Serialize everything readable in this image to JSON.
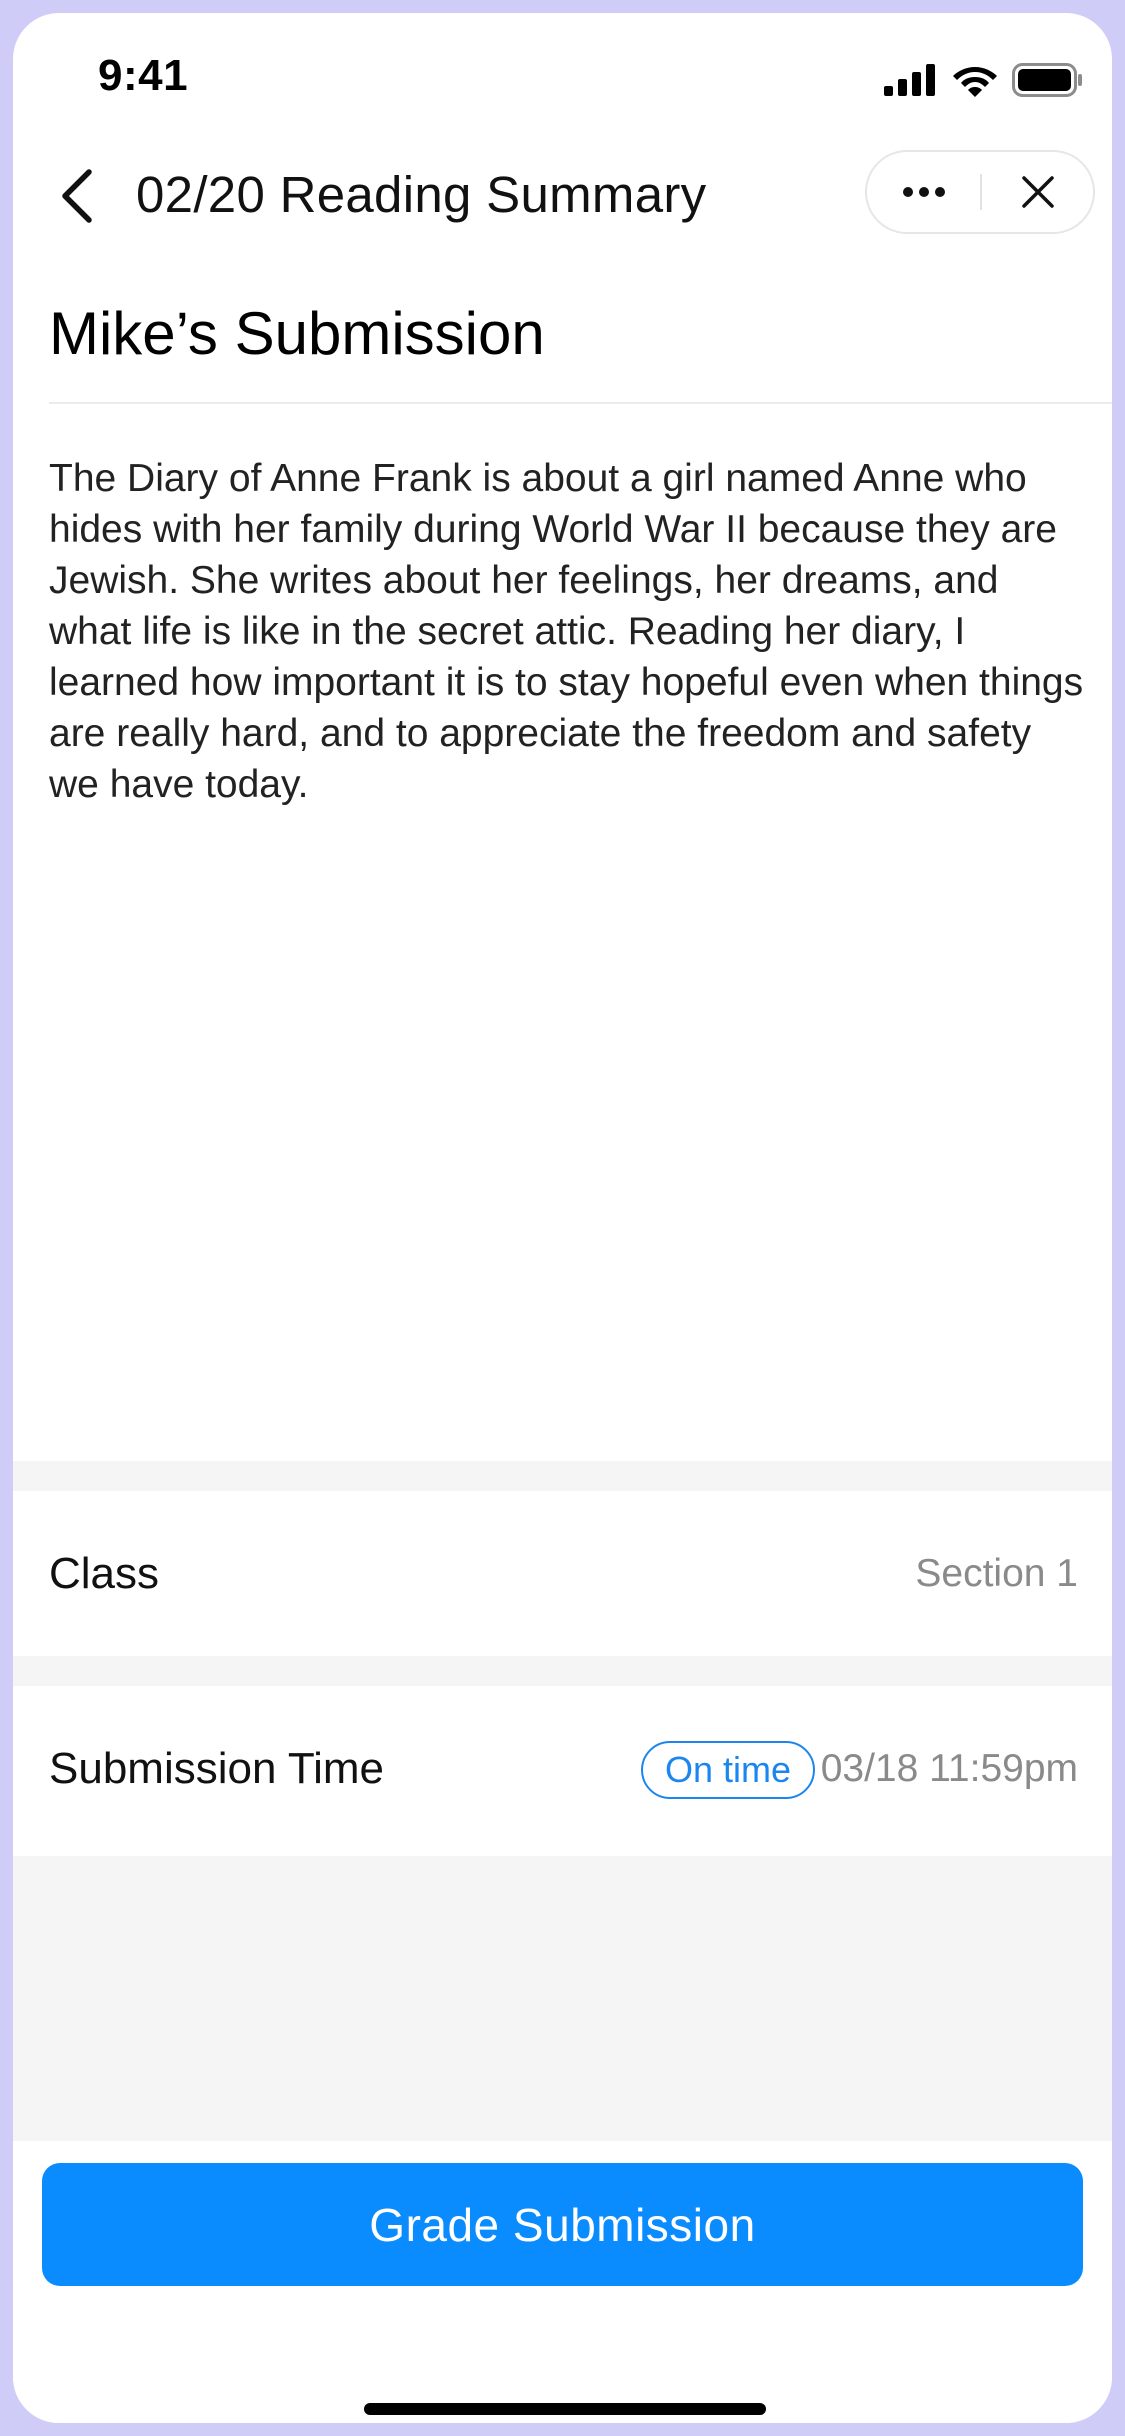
{
  "status_bar": {
    "time": "9:41"
  },
  "nav": {
    "title": "02/20 Reading Summary"
  },
  "submission": {
    "heading": "Mike’s Submission",
    "text": "The Diary of Anne Frank is about a girl named Anne who hides with her family during World War II because they are Jewish. She writes about her feelings, her dreams, and what life is like in the secret attic. Reading her diary, I learned how important it is to stay hopeful even when things are really hard, and to appreciate the freedom and safety we have today."
  },
  "details": {
    "class_label": "Class",
    "class_value": "Section 1",
    "time_label": "Submission Time",
    "time_badge": "On time",
    "time_value": "03/18 11:59pm"
  },
  "footer": {
    "grade_button": "Grade Submission"
  },
  "colors": {
    "accent": "#0a8cff",
    "badge": "#1b86f0",
    "frame": "#cfcdf7",
    "section_bg": "#f5f5f5"
  },
  "icons": {
    "back": "chevron-left-icon",
    "more": "more-dots-icon",
    "close": "close-icon",
    "signal": "signal-icon",
    "wifi": "wifi-icon",
    "battery": "battery-icon"
  }
}
